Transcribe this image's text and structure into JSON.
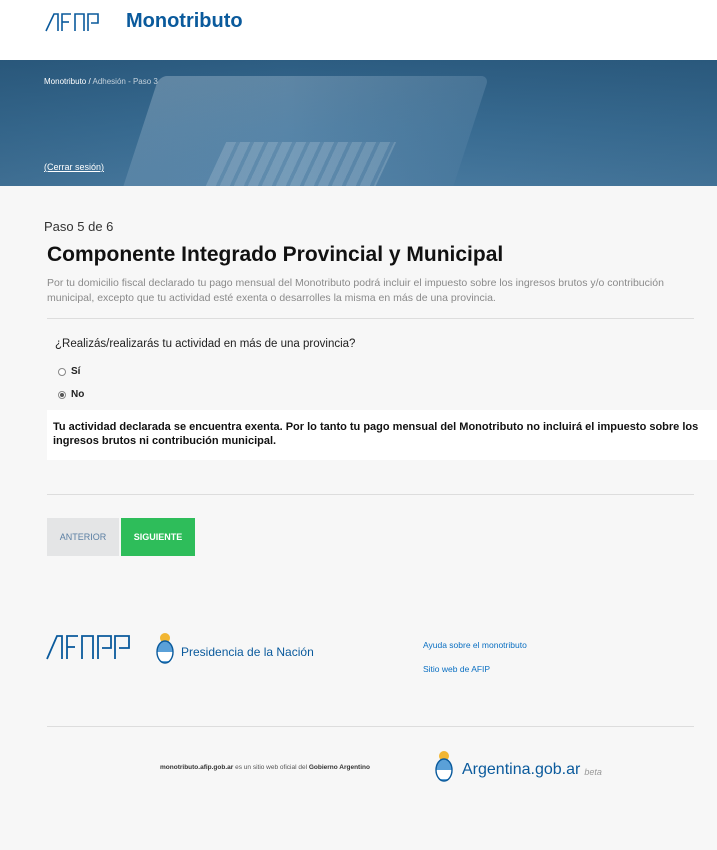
{
  "header": {
    "brand_logo_text": "AFIP",
    "brand_name": "Monotributo"
  },
  "hero": {
    "breadcrumb": {
      "root": "Monotributo",
      "separator": "/",
      "current": "Adhesión - Paso 3"
    },
    "logout_label": "(Cerrar sesión)"
  },
  "form": {
    "step": "Paso 5 de 6",
    "title": "Componente Integrado Provincial y Municipal",
    "description": "Por tu domicilio fiscal declarado tu pago mensual del Monotributo podrá incluir el impuesto sobre los ingresos brutos y/o contribución municipal, excepto que tu actividad esté exenta o desarrolles la misma en más de una provincia.",
    "question": "¿Realizás/realizarás tu actividad en más de una provincia?",
    "options": [
      {
        "label": "Sí",
        "checked": false
      },
      {
        "label": "No",
        "checked": true
      }
    ],
    "notice": "Tu actividad declarada se encuentra exenta. Por lo tanto tu pago mensual del Monotributo no incluirá el impuesto sobre los ingresos brutos ni contribución municipal.",
    "buttons": {
      "prev_label": "ANTERIOR",
      "next_label": "SIGUIENTE"
    }
  },
  "footer": {
    "afip_logo_text": "AFIP",
    "presidencia_label": "Presidencia de la Nación",
    "links": [
      {
        "label": "Ayuda sobre el monotributo"
      },
      {
        "label": "Sitio web de AFIP"
      }
    ],
    "legal": {
      "domain": "monotributo.afip.gob.ar",
      "middle": "es un sitio web oficial del",
      "owner": "Gobierno Argentino"
    },
    "argentina_label": "Argentina.gob.ar",
    "beta_label": "beta"
  },
  "colors": {
    "brand_blue": "#0a5a9c",
    "hero_blue": "#3b6f96",
    "next_green": "#2ebd5a",
    "prev_gray": "#e4e5e6",
    "link_blue": "#0a6fc2"
  }
}
